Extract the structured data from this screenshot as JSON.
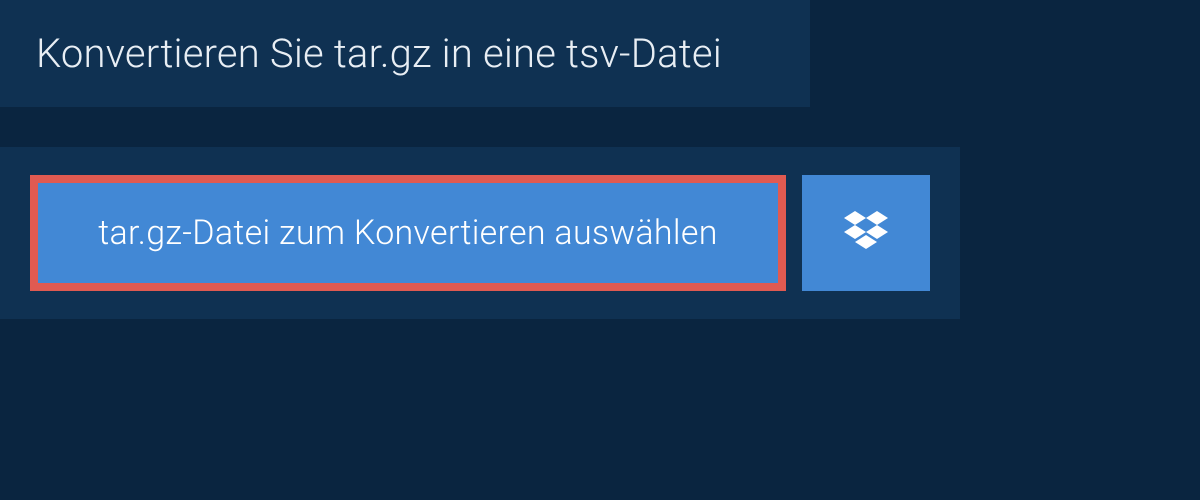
{
  "header": {
    "title": "Konvertieren Sie tar.gz in eine tsv-Datei"
  },
  "upload": {
    "select_file_label": "tar.gz-Datei zum Konvertieren auswählen"
  },
  "colors": {
    "page_bg": "#0a2540",
    "panel_bg": "#0f3152",
    "button_bg": "#4288d5",
    "highlight_border": "#e05a51",
    "text_light": "#e8eef4",
    "text_white": "#ffffff"
  },
  "icons": {
    "dropbox": "dropbox-icon"
  }
}
